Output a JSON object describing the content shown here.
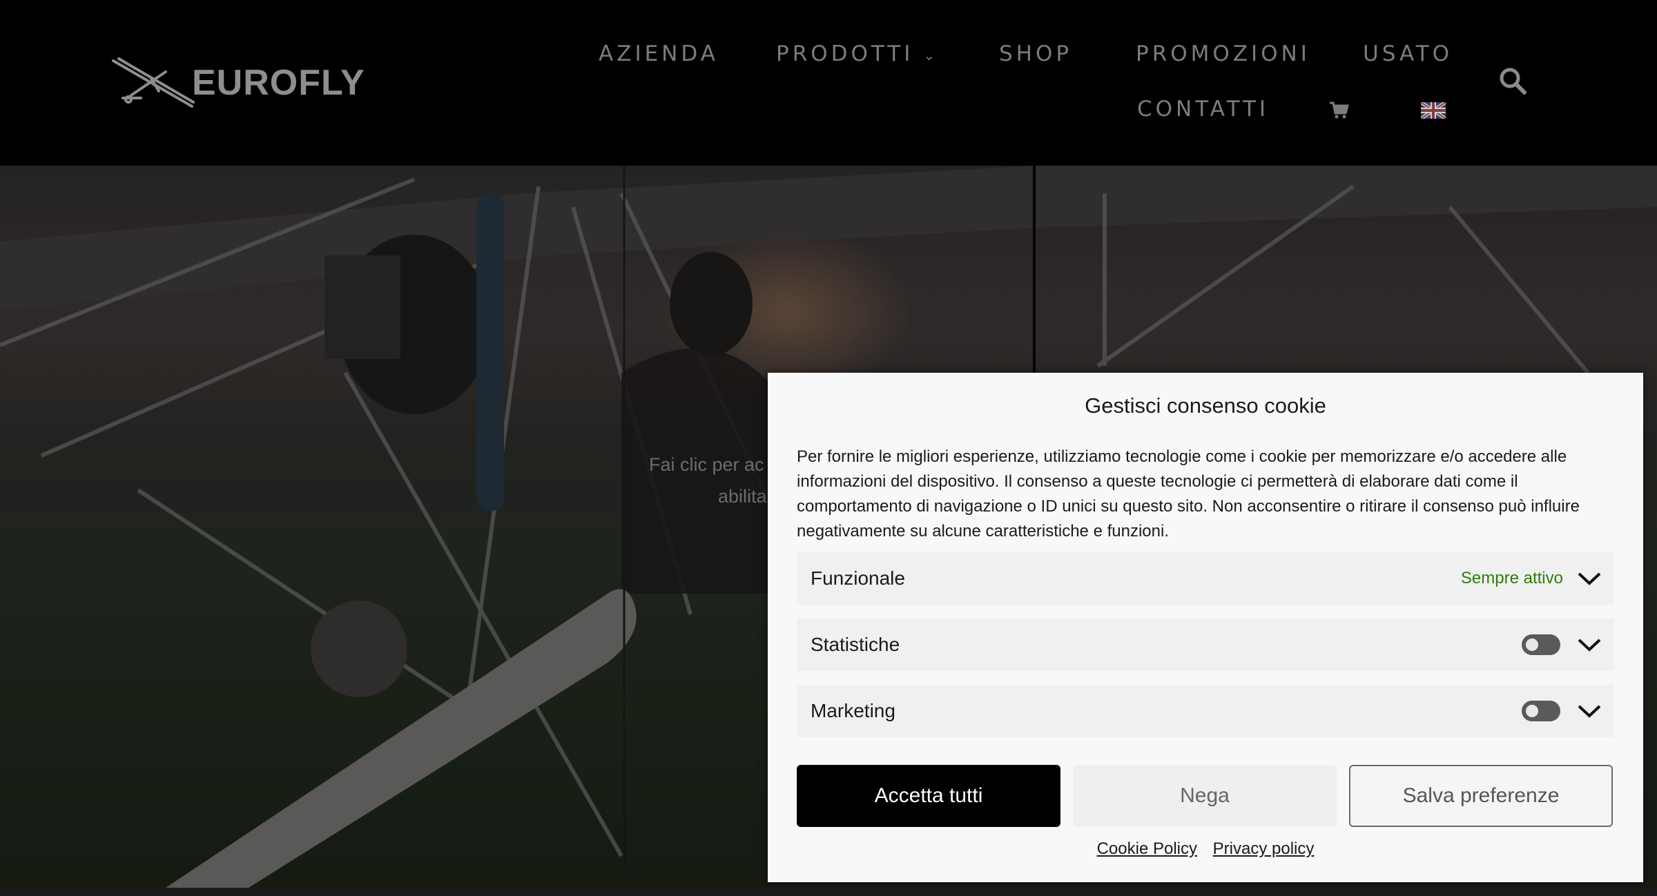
{
  "header": {
    "logo_text": "EUROFLY",
    "nav": {
      "azienda": "AZIENDA",
      "prodotti": "PRODOTTI",
      "shop": "SHOP",
      "promozioni": "PROMOZIONI",
      "usato": "USATO",
      "contatti": "CONTATTI"
    },
    "icons": [
      "cart-icon",
      "uk-flag-icon",
      "search-icon",
      "chevron-down-icon"
    ]
  },
  "hero": {
    "placeholder_text_line1": "Fai clic per ac",
    "placeholder_text_line2": "abilita"
  },
  "cookie_banner": {
    "title": "Gestisci consenso cookie",
    "description": "Per fornire le migliori esperienze, utilizziamo tecnologie come i cookie per memorizzare e/o accedere alle informazioni del dispositivo. Il consenso a queste tecnologie ci permetterà di elaborare dati come il comportamento di navigazione o ID unici su questo sito. Non acconsentire o ritirare il consenso può influire negativamente su alcune caratteristiche e funzioni.",
    "categories": [
      {
        "label": "Funzionale",
        "status": "Sempre attivo"
      },
      {
        "label": "Statistiche",
        "enabled": false
      },
      {
        "label": "Marketing",
        "enabled": false
      }
    ],
    "buttons": {
      "accept": "Accetta tutti",
      "deny": "Nega",
      "save": "Salva preferenze"
    },
    "links": {
      "cookie_policy": "Cookie Policy",
      "privacy_policy": "Privacy policy"
    }
  },
  "colors": {
    "header_bg": "#000000",
    "nav_text": "#7c7c7c",
    "always_active": "#2e7d0a",
    "accept_bg": "#000000"
  }
}
